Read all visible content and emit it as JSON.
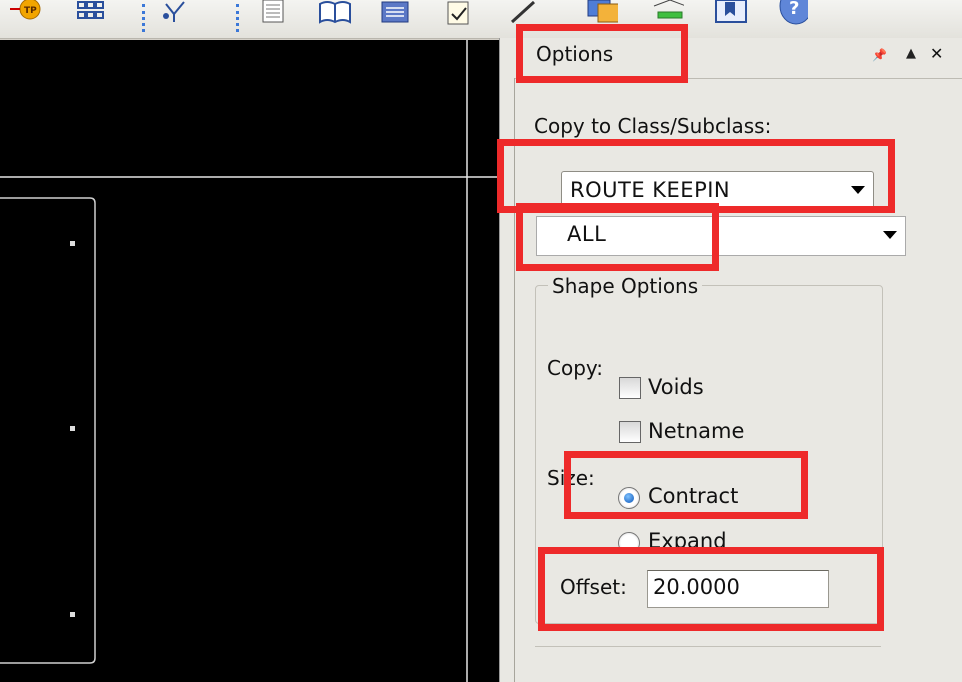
{
  "panel": {
    "title": "Options",
    "pin_glyph": "📌",
    "up_glyph": "▲",
    "close_glyph": "✕",
    "copy_to_label": "Copy to Class/Subclass:",
    "class_select": {
      "value": "ROUTE KEEPIN"
    },
    "subclass_select": {
      "value": "ALL"
    },
    "shape_options_label": "Shape Options",
    "copy_label": "Copy:",
    "voids_label": "Voids",
    "netname_label": "Netname",
    "size_label": "Size:",
    "contract_label": "Contract",
    "expand_label": "Expand",
    "offset_label": "Offset:",
    "offset_value": "20.0000"
  },
  "state": {
    "contract_selected": true,
    "voids_checked": false,
    "netname_checked": false
  },
  "icons": [
    "tp-icon",
    "grid-icon",
    "fork-icon",
    "document-icon",
    "book-icon",
    "chip-icon",
    "checklist-icon",
    "pen-icon",
    "copy-icon",
    "monitor-icon",
    "bookmark-icon",
    "help-icon"
  ],
  "colors": {
    "highlight": "#ee2a2a",
    "canvas": "#000000"
  }
}
